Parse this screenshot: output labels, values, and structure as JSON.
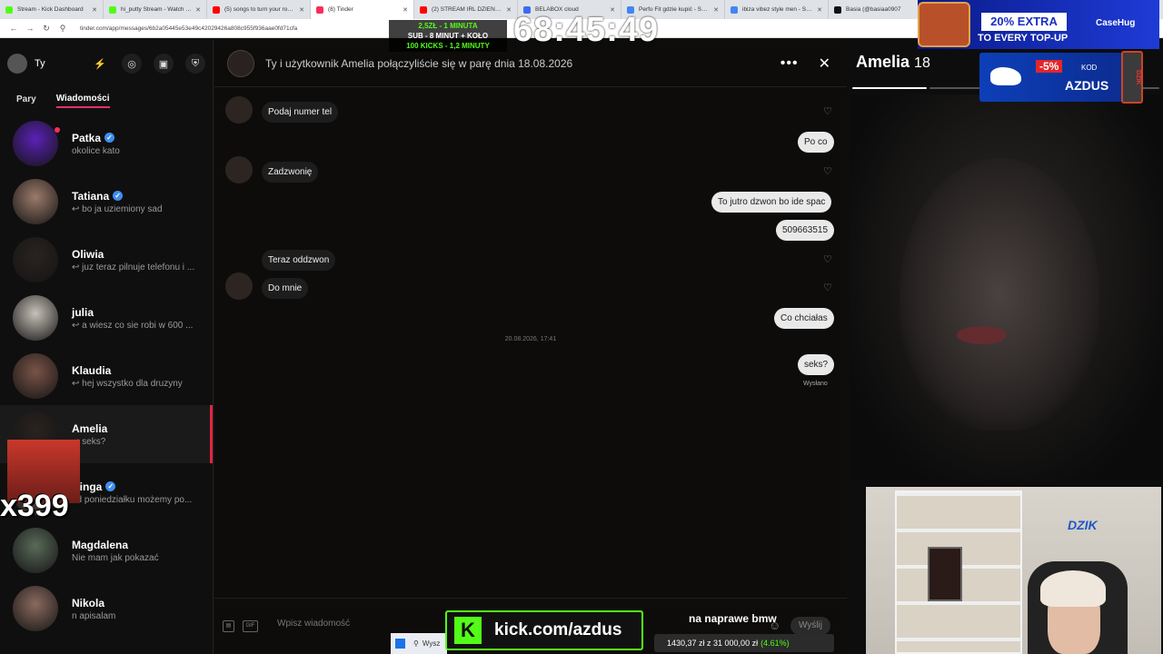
{
  "browser": {
    "tabs": [
      {
        "label": "Stream - Kick Dashboard",
        "color": "#53fc18"
      },
      {
        "label": "hi_putty Stream - Watch Live",
        "color": "#53fc18"
      },
      {
        "label": "(5) songs to turn your room in",
        "color": "#ff0000"
      },
      {
        "label": "(8) Tinder",
        "color": "#fd2d5d"
      },
      {
        "label": "(2) STREAM IRL DZIEŃ 2 WEB",
        "color": "#ff0000"
      },
      {
        "label": "BELABOX cloud",
        "color": "#3a6df0"
      },
      {
        "label": "Perfo Fit gdzie kupić - Szukaj",
        "color": "#4285f4"
      },
      {
        "label": "ibiza vibez style men - Szukaj",
        "color": "#4285f4"
      },
      {
        "label": "Basia (@basiaa0907",
        "color": "#111111"
      }
    ],
    "url": "tinder.com/app/messages/6b2a05445e53e49c42029426a808c955f936aae0fd71cfa"
  },
  "sidebar": {
    "me_label": "Ty",
    "tabs": [
      {
        "label": "Pary",
        "active": false
      },
      {
        "label": "Wiadomości",
        "active": true
      }
    ],
    "conversations": [
      {
        "name": "Patka",
        "verified": true,
        "preview": "okolice kato",
        "color": "#5b21b6"
      },
      {
        "name": "Tatiana",
        "verified": true,
        "preview": "↩ bo ja uziemiony sad",
        "color": "#9b7a6a"
      },
      {
        "name": "Oliwia",
        "verified": false,
        "preview": "↩ juz teraz pilnuje telefonu i ...",
        "color": "#2a2320"
      },
      {
        "name": "julia",
        "verified": false,
        "preview": "↩ a wiesz co sie robi w 600 ...",
        "color": "#c7c1b8"
      },
      {
        "name": "Klaudia",
        "verified": false,
        "preview": "↩ hej wszystko dla druzyny",
        "color": "#7a5448"
      },
      {
        "name": "Amelia",
        "verified": false,
        "preview": "↩ seks?",
        "color": "#2a2320",
        "selected": true
      },
      {
        "name": "Kinga",
        "verified": true,
        "preview": "od poniedziałku możemy po...",
        "color": "#6b5a4a"
      },
      {
        "name": "Magdalena",
        "verified": false,
        "preview": "Nie mam jak pokazać",
        "color": "#5a6a5a"
      },
      {
        "name": "Nikola",
        "verified": false,
        "preview": "n apisalam",
        "color": "#8a6a5f"
      }
    ]
  },
  "chat": {
    "match_text": "Ty i użytkownik Amelia połączyliście się w parę dnia 18.08.2026",
    "messages": [
      {
        "text": "Podaj numer tel"
      },
      {
        "text": "Po co"
      },
      {
        "text": "Zadzwonię"
      },
      {
        "text": "To jutro dzwon bo ide spac"
      },
      {
        "text": "509663515"
      },
      {
        "text": "Teraz oddzwon"
      },
      {
        "text": "Do mnie"
      },
      {
        "text": "Co chciałas"
      },
      {
        "text": "seks?"
      }
    ],
    "date_separator": "20.08.2026, 17:41",
    "sent_label": "Wysłano",
    "composer": {
      "placeholder": "Wpisz wiadomość",
      "gif_label": "GIF",
      "send_label": "Wyślij"
    }
  },
  "profile": {
    "name": "Amelia",
    "age": "18",
    "photos_total": 4,
    "photo_index": 1
  },
  "overlays": {
    "timer": "68:45:49",
    "goals": [
      "2,5ZŁ - 1 MINUTA",
      "SUB - 8 MINUT + KOŁO",
      "100 KICKS - 1,2 MINUTY"
    ],
    "ad_top_extra": "20% EXTRA",
    "ad_top_line": "TO EVERY TOP-UP",
    "ad_top_brand": "CaseHug",
    "ad_dzik_discount": "-5%",
    "ad_dzik_kod": "KOD",
    "ad_dzik_code": "AZDUS",
    "ad_dzik_can": "DZIK",
    "multiplier": "x399",
    "cam_logo": "DZIK",
    "kick_url": "kick.com/azdus",
    "caption": "na naprawe bmw",
    "taskbar_search": "Wysz",
    "stock_text": "1430,37 zł z 31 000,00 zł",
    "stock_pct": "(4.61%)"
  }
}
